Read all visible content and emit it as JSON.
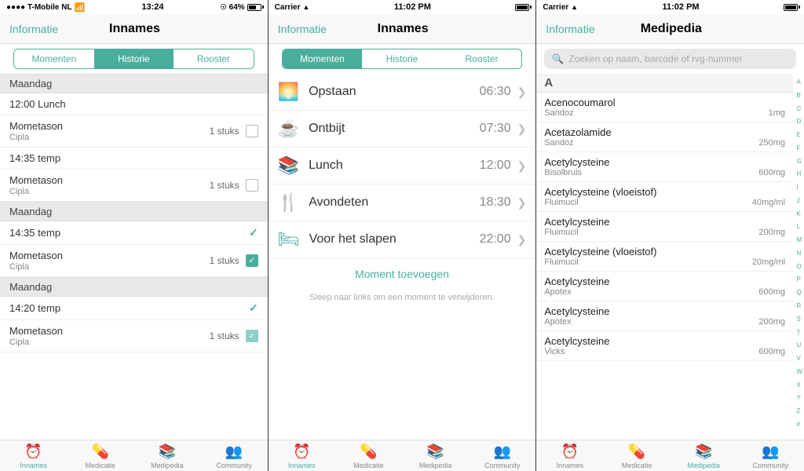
{
  "panel1": {
    "status": {
      "carrier": "●●●● T-Mobile NL",
      "time": "13:24",
      "wifi": "wifi",
      "bluetooth": "bt",
      "battery": "64%"
    },
    "nav": {
      "back": "Informatie",
      "title": "Innames"
    },
    "segments": [
      "Momenten",
      "Historie",
      "Rooster"
    ],
    "activeSegment": 1,
    "sections": [
      {
        "header": "Maandag",
        "items": [
          {
            "title": "12:00 Lunch",
            "subtitle": "",
            "count": "",
            "checked": false,
            "checkmark": false
          }
        ]
      },
      {
        "header": "",
        "items": [
          {
            "title": "Mometason",
            "subtitle": "Cipla",
            "count": "1 stuks",
            "checked": false,
            "checkmark": false
          }
        ]
      },
      {
        "header": "",
        "items": [
          {
            "title": "14:35 temp",
            "subtitle": "",
            "count": "",
            "checked": false,
            "checkmark": false
          }
        ]
      },
      {
        "header": "",
        "items": [
          {
            "title": "Mometason",
            "subtitle": "Cipla",
            "count": "1 stuks",
            "checked": false,
            "checkmark": false
          }
        ]
      }
    ],
    "sections2": [
      {
        "header": "Maandag"
      },
      {
        "title": "14:35 temp",
        "checkmark": true
      },
      {
        "title": "Mometason",
        "subtitle": "Cipla",
        "count": "1 stuks",
        "checked": true
      }
    ],
    "sections3": [
      {
        "header": "Maandag"
      },
      {
        "title": "14:20 temp",
        "checkmark": true
      },
      {
        "title": "Mometason",
        "subtitle": "Cipla",
        "count": "1 stuks",
        "partial": true
      }
    ],
    "tabs": [
      {
        "icon": "⏰",
        "label": "Innames",
        "active": true
      },
      {
        "icon": "💊",
        "label": "Medicatie",
        "active": false
      },
      {
        "icon": "📚",
        "label": "Medipedia",
        "active": false
      },
      {
        "icon": "👥",
        "label": "Community",
        "active": false
      }
    ]
  },
  "panel2": {
    "status": {
      "carrier": "Carrier",
      "time": "11:02 PM",
      "battery": "full"
    },
    "nav": {
      "back": "Informatie",
      "title": "Innames"
    },
    "segments": [
      "Momenten",
      "Historie",
      "Rooster"
    ],
    "activeSegment": 0,
    "moments": [
      {
        "icon": "🌅",
        "name": "Opstaan",
        "time": "06:30"
      },
      {
        "icon": "☕",
        "name": "Ontbijt",
        "time": "07:30"
      },
      {
        "icon": "📚",
        "name": "Lunch",
        "time": "12:00"
      },
      {
        "icon": "🍴",
        "name": "Avondeten",
        "time": "18:30"
      },
      {
        "icon": "🛏",
        "name": "Voor het slapen",
        "time": "22:00"
      }
    ],
    "addButton": "Moment toevoegen",
    "hint": "Sleep naar links om een moment te verwijderen.",
    "tabs": [
      {
        "icon": "⏰",
        "label": "Innames",
        "active": true
      },
      {
        "icon": "💊",
        "label": "Medicatie",
        "active": false
      },
      {
        "icon": "📚",
        "label": "Medipedia",
        "active": false
      },
      {
        "icon": "👥",
        "label": "Community",
        "active": false
      }
    ]
  },
  "panel3": {
    "status": {
      "carrier": "Carrier",
      "time": "11:02 PM",
      "battery": "full"
    },
    "nav": {
      "back": "Informatie",
      "title": "Medipedia"
    },
    "search": {
      "placeholder": "Zoeken op naam, barcode of rvg-nummer"
    },
    "alphabet": [
      "A",
      "B",
      "C",
      "D",
      "E",
      "F",
      "G",
      "H",
      "I",
      "J",
      "K",
      "L",
      "M",
      "N",
      "O",
      "P",
      "Q",
      "R",
      "S",
      "T",
      "U",
      "V",
      "W",
      "X",
      "Y",
      "Z",
      "#"
    ],
    "sections": [
      {
        "letter": "A",
        "items": [
          {
            "name": "Acenocoumarol",
            "brand": "Sandoz",
            "dose": "1mg"
          },
          {
            "name": "Acetazolamide",
            "brand": "Sandoz",
            "dose": "250mg"
          },
          {
            "name": "Acetylcysteine",
            "brand": "Bisolbruis",
            "dose": "600mg"
          },
          {
            "name": "Acetylcysteine (vloeistof)",
            "brand": "Fluimucil",
            "dose": "40mg/ml"
          },
          {
            "name": "Acetylcysteine",
            "brand": "Fluimucil",
            "dose": "200mg"
          },
          {
            "name": "Acetylcysteine (vloeistof)",
            "brand": "Fluimucil",
            "dose": "20mg/ml"
          },
          {
            "name": "Acetylcysteine",
            "brand": "Apotex",
            "dose": "600mg"
          },
          {
            "name": "Acetylcysteine",
            "brand": "Apotex",
            "dose": "200mg"
          },
          {
            "name": "Acetylcysteine",
            "brand": "Vicks",
            "dose": "600mg"
          }
        ]
      }
    ],
    "tabs": [
      {
        "icon": "⏰",
        "label": "Innames",
        "active": false
      },
      {
        "icon": "💊",
        "label": "Medicatie",
        "active": false
      },
      {
        "icon": "📚",
        "label": "Medipedia",
        "active": true
      },
      {
        "icon": "👥",
        "label": "Community",
        "active": false
      }
    ]
  }
}
